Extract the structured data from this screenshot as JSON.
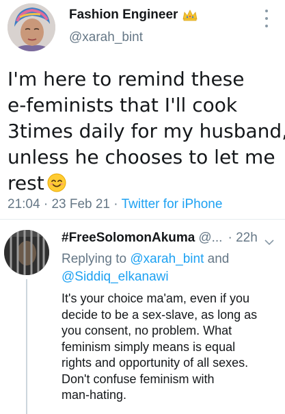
{
  "tweet": {
    "author_name": "Fashion Engineer",
    "author_badge_icon": "crown-icon",
    "author_handle": "@xarah_bint",
    "text_lines": [
      "I'm here to remind these",
      "e-feminists that I'll cook",
      "3times daily for my husband,",
      "unless he chooses to let me",
      "rest"
    ],
    "emoji": "smiling-face-icon",
    "time": "21:04",
    "date": "23 Feb 21",
    "source": "Twitter for iPhone",
    "separator": "·"
  },
  "reply": {
    "author_name": "#FreeSolomonAkuma",
    "author_handle": "@...",
    "time_ago": "22h",
    "replying_prefix": "Replying to",
    "replying_mention_1": "@xarah_bint",
    "replying_and": "and",
    "replying_mention_2": "@Siddiq_elkanawi",
    "text_lines": [
      "It's your choice ma'am, even if you",
      "decide to be a sex-slave, as long as",
      "you consent, no problem. What",
      "feminism simply means is equal",
      "rights and opportunity of all sexes.",
      "Don't confuse feminism with",
      "man-hating."
    ]
  },
  "colors": {
    "text": "#14171a",
    "secondary": "#657786",
    "link": "#1da1f2",
    "divider": "#e6ecf0"
  }
}
